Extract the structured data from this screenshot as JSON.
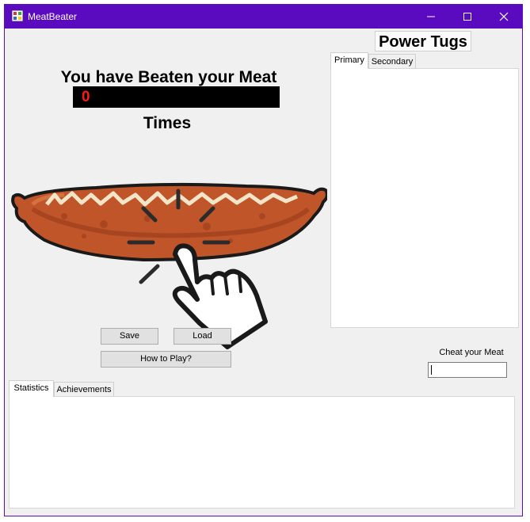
{
  "window": {
    "title": "MeatBeater"
  },
  "main": {
    "headline": "You have Beaten your Meat",
    "count": "0",
    "times_label": "Times"
  },
  "power_tugs": {
    "title": "Power Tugs",
    "tabs": [
      {
        "label": "Primary"
      },
      {
        "label": "Secondary"
      }
    ]
  },
  "buttons": {
    "save": "Save",
    "load": "Load",
    "how_to_play": "How to Play?"
  },
  "cheat": {
    "label": "Cheat your Meat",
    "value": ""
  },
  "bottom_tabs": [
    {
      "label": "Statistics"
    },
    {
      "label": "Achievements"
    }
  ],
  "colors": {
    "titlebar": "#5b0bbf",
    "counter_bg": "#000000",
    "counter_text": "#ff1a1a",
    "sausage": "#c0552a"
  },
  "icons": {
    "meat_image": "sausage-with-pointing-hand-icon",
    "app": "app-icon"
  }
}
